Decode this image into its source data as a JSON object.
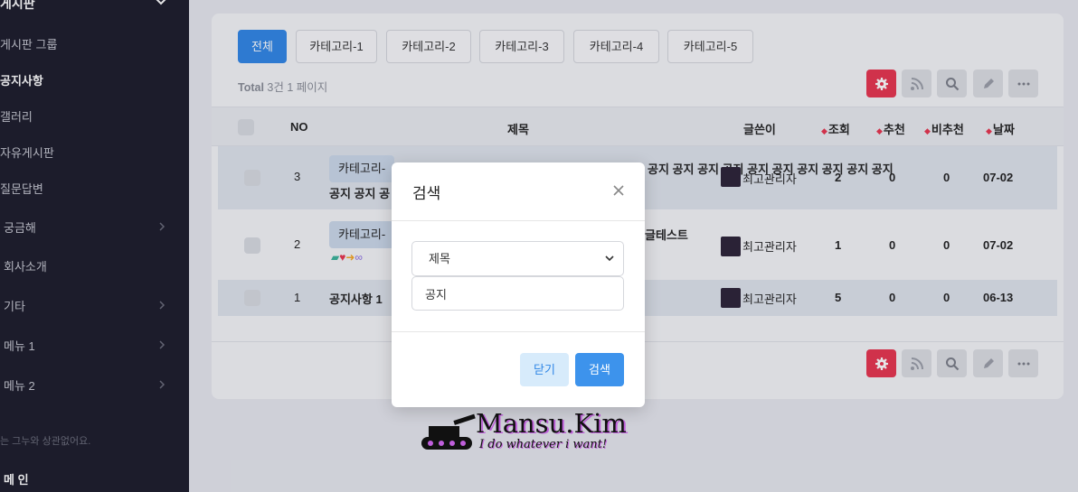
{
  "sidebar": {
    "section_title": "게시판",
    "items": [
      {
        "label": "게시판 그룹",
        "active": false
      },
      {
        "label": "공지사항",
        "active": true
      },
      {
        "label": "갤러리",
        "active": false
      },
      {
        "label": "자유게시판",
        "active": false
      },
      {
        "label": "질문답변",
        "active": false
      },
      {
        "label": "궁금해",
        "active": false
      },
      {
        "label": "회사소개",
        "active": false
      },
      {
        "label": "기타",
        "active": false
      },
      {
        "label": "메뉴 1",
        "active": false
      },
      {
        "label": "메뉴 2",
        "active": false
      }
    ],
    "note": "는 그누와 상관없어요.",
    "main_label": "메 인"
  },
  "categories": [
    "전체",
    "카테고리-1",
    "카테고리-2",
    "카테고리-3",
    "카테고리-4",
    "카테고리-5"
  ],
  "total": {
    "prefix": "Total",
    "count": "3건",
    "page": "1 페이지"
  },
  "table": {
    "headers": {
      "no": "NO",
      "title": "제목",
      "author": "글쓴이",
      "views": "조회",
      "recommend": "추천",
      "notrecommend": "비추천",
      "date": "날짜"
    },
    "rows": [
      {
        "no": "3",
        "tag": "카테고리-",
        "title_line1": "공지 공지 공지 공지 공지 공지 공지 공지 공지 공지",
        "title_line2": "공지 공지 공",
        "author": "최고관리자",
        "views": "2",
        "rec": "0",
        "notrec": "0",
        "date": "07-02"
      },
      {
        "no": "2",
        "tag": "카테고리-",
        "title_line1": "글테스트",
        "title_line2": "",
        "author": "최고관리자",
        "views": "1",
        "rec": "0",
        "notrec": "0",
        "date": "07-02"
      },
      {
        "no": "1",
        "tag": "",
        "title_line1": "공지사항 1",
        "title_line2": "",
        "author": "최고관리자",
        "views": "5",
        "rec": "0",
        "notrec": "0",
        "date": "06-13"
      }
    ]
  },
  "logo": {
    "name": "Mansu.Kim",
    "tagline": "I do whatever i want!"
  },
  "modal": {
    "title": "검색",
    "select_value": "제목",
    "input_value": "공지",
    "close_label": "닫기",
    "search_label": "검색"
  },
  "colors": {
    "primary": "#2f86e6",
    "danger": "#e8344e",
    "sidebar": "#1b1b29"
  }
}
